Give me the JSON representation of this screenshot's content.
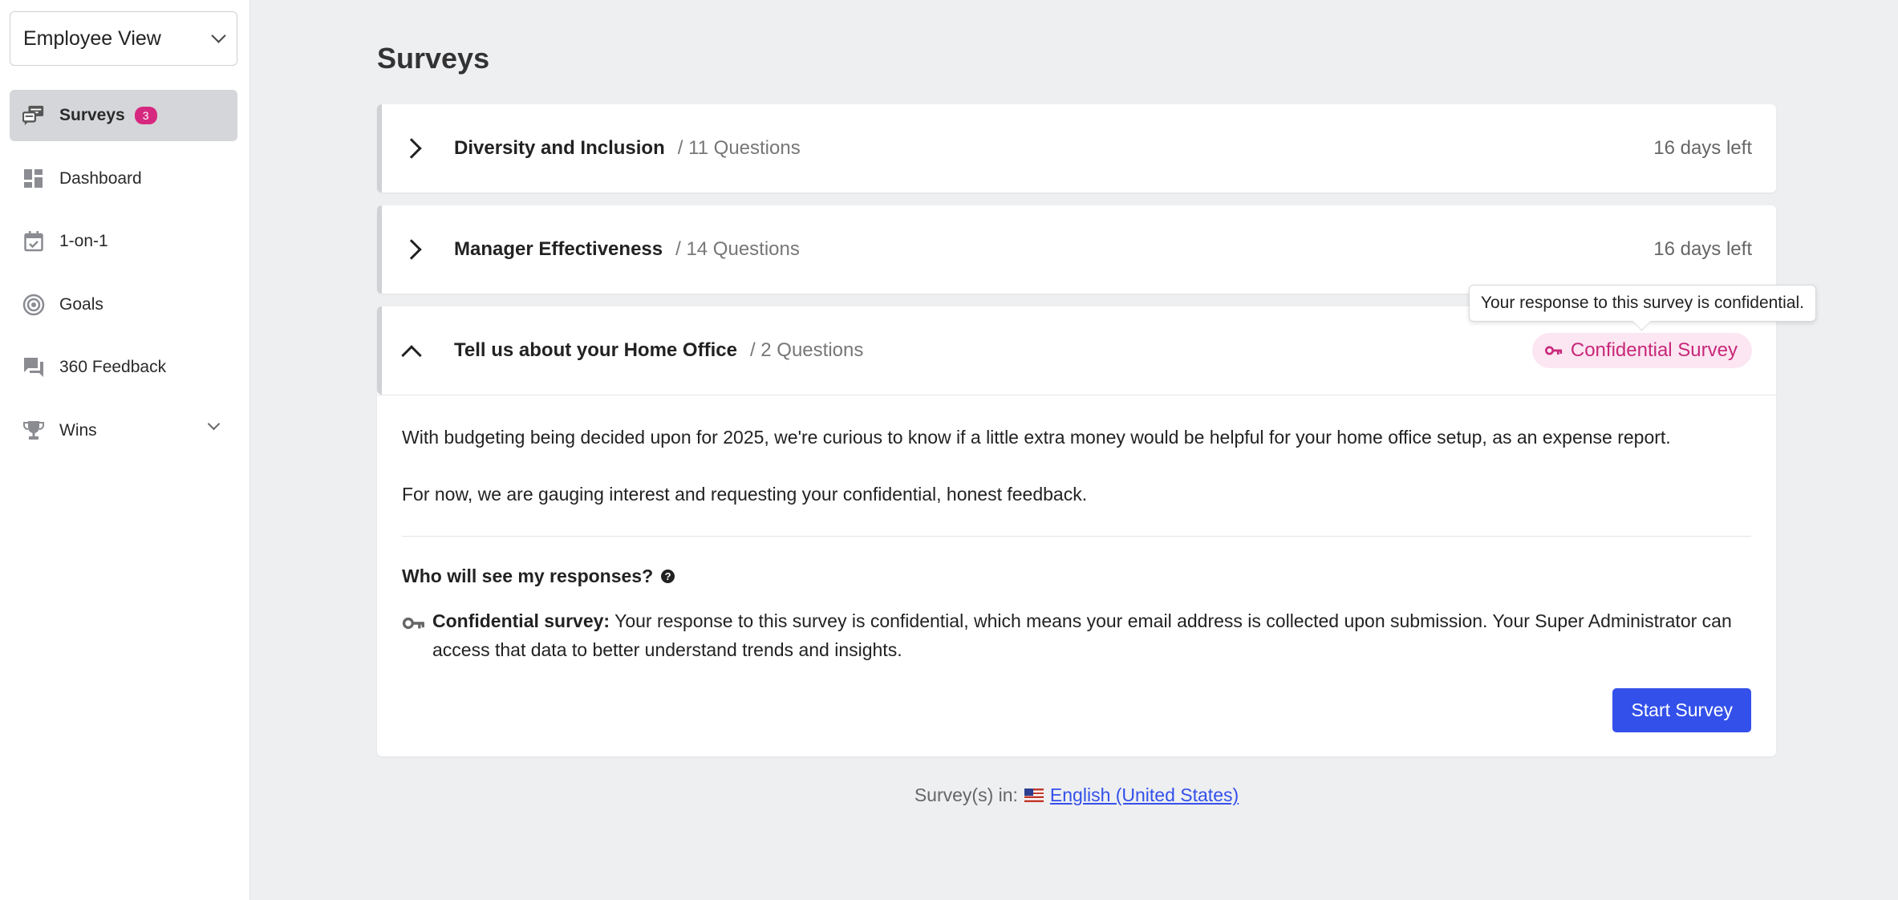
{
  "sidebar": {
    "view_select": "Employee View",
    "items": [
      {
        "label": "Surveys",
        "badge": "3",
        "icon": "surveys-icon",
        "active": true
      },
      {
        "label": "Dashboard",
        "icon": "dashboard-icon"
      },
      {
        "label": "1-on-1",
        "icon": "calendar-check-icon"
      },
      {
        "label": "Goals",
        "icon": "target-icon"
      },
      {
        "label": "360 Feedback",
        "icon": "feedback-icon"
      },
      {
        "label": "Wins",
        "icon": "trophy-icon"
      }
    ]
  },
  "main": {
    "title": "Surveys",
    "surveys": [
      {
        "title": "Diversity and Inclusion",
        "questions": "/ 11 Questions",
        "status": "16 days left"
      },
      {
        "title": "Manager Effectiveness",
        "questions": "/ 14 Questions",
        "status": "16 days left"
      },
      {
        "title": "Tell us about your Home Office",
        "questions": "/ 2 Questions",
        "pill": "Confidential Survey",
        "tooltip": "Your response to this survey is confidential.",
        "description_1": "With budgeting being decided upon for 2025, we're curious to know if a little extra money would be helpful for your home office setup, as an expense report.",
        "description_2": "For now, we are gauging interest and requesting your confidential, honest feedback.",
        "who_heading": "Who will see my responses?",
        "help_glyph": "?",
        "conf_label": "Confidential survey:",
        "conf_text": " Your response to this survey is confidential, which means your email address is collected upon submission. Your Super Administrator can access that data to better understand trends and insights.",
        "start_button": "Start Survey"
      }
    ]
  },
  "footer": {
    "prefix": "Survey(s) in:",
    "language": "English (United States)"
  },
  "colors": {
    "accent": "#3350ea",
    "badge": "#d6287f",
    "confidential": "#c8287a"
  }
}
